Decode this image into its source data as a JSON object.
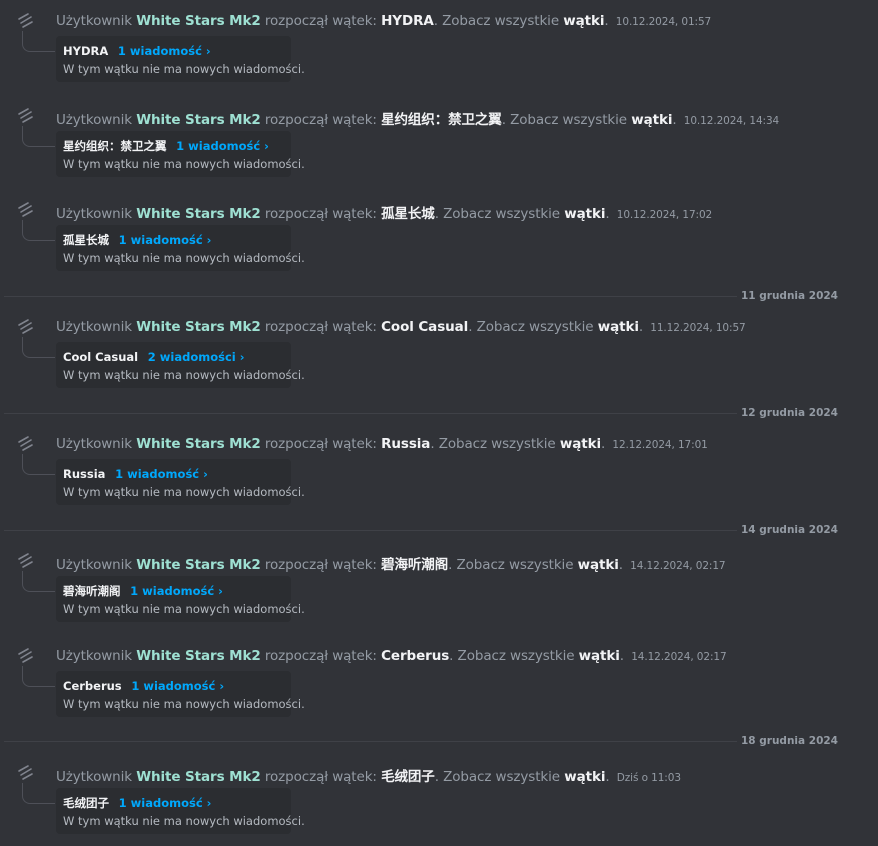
{
  "strings": {
    "user_prefix": "Użytkownik",
    "started": "rozpoczął wątek:",
    "see_all": "Zobacz wszystkie",
    "threads_word": "wątki",
    "no_new": "W tym wątku nie ma nowych wiadomości."
  },
  "username": "White Stars Mk2",
  "dividers": [
    {
      "label": "11 grudnia 2024"
    },
    {
      "label": "12 grudnia 2024"
    },
    {
      "label": "14 grudnia 2024"
    },
    {
      "label": "18 grudnia 2024"
    }
  ],
  "threads": [
    {
      "title": "HYDRA",
      "timestamp": "10.12.2024, 01:57",
      "count": "1 wiadomość ›"
    },
    {
      "title": "星约组织：禁卫之翼",
      "timestamp": "10.12.2024, 14:34",
      "count": "1 wiadomość ›"
    },
    {
      "title": "孤星长城",
      "timestamp": "10.12.2024, 17:02",
      "count": "1 wiadomość ›"
    },
    {
      "title": "Cool Casual",
      "timestamp": "11.12.2024, 10:57",
      "count": "2 wiadomości ›"
    },
    {
      "title": "Russia",
      "timestamp": "12.12.2024, 17:01",
      "count": "1 wiadomość ›"
    },
    {
      "title": "碧海听潮阁",
      "timestamp": "14.12.2024, 02:17",
      "count": "1 wiadomość ›"
    },
    {
      "title": "Cerberus",
      "timestamp": "14.12.2024, 02:17",
      "count": "1 wiadomość ›"
    },
    {
      "title": "毛绒团子",
      "timestamp": "Dziś o 11:03",
      "count": "1 wiadomość ›"
    }
  ]
}
